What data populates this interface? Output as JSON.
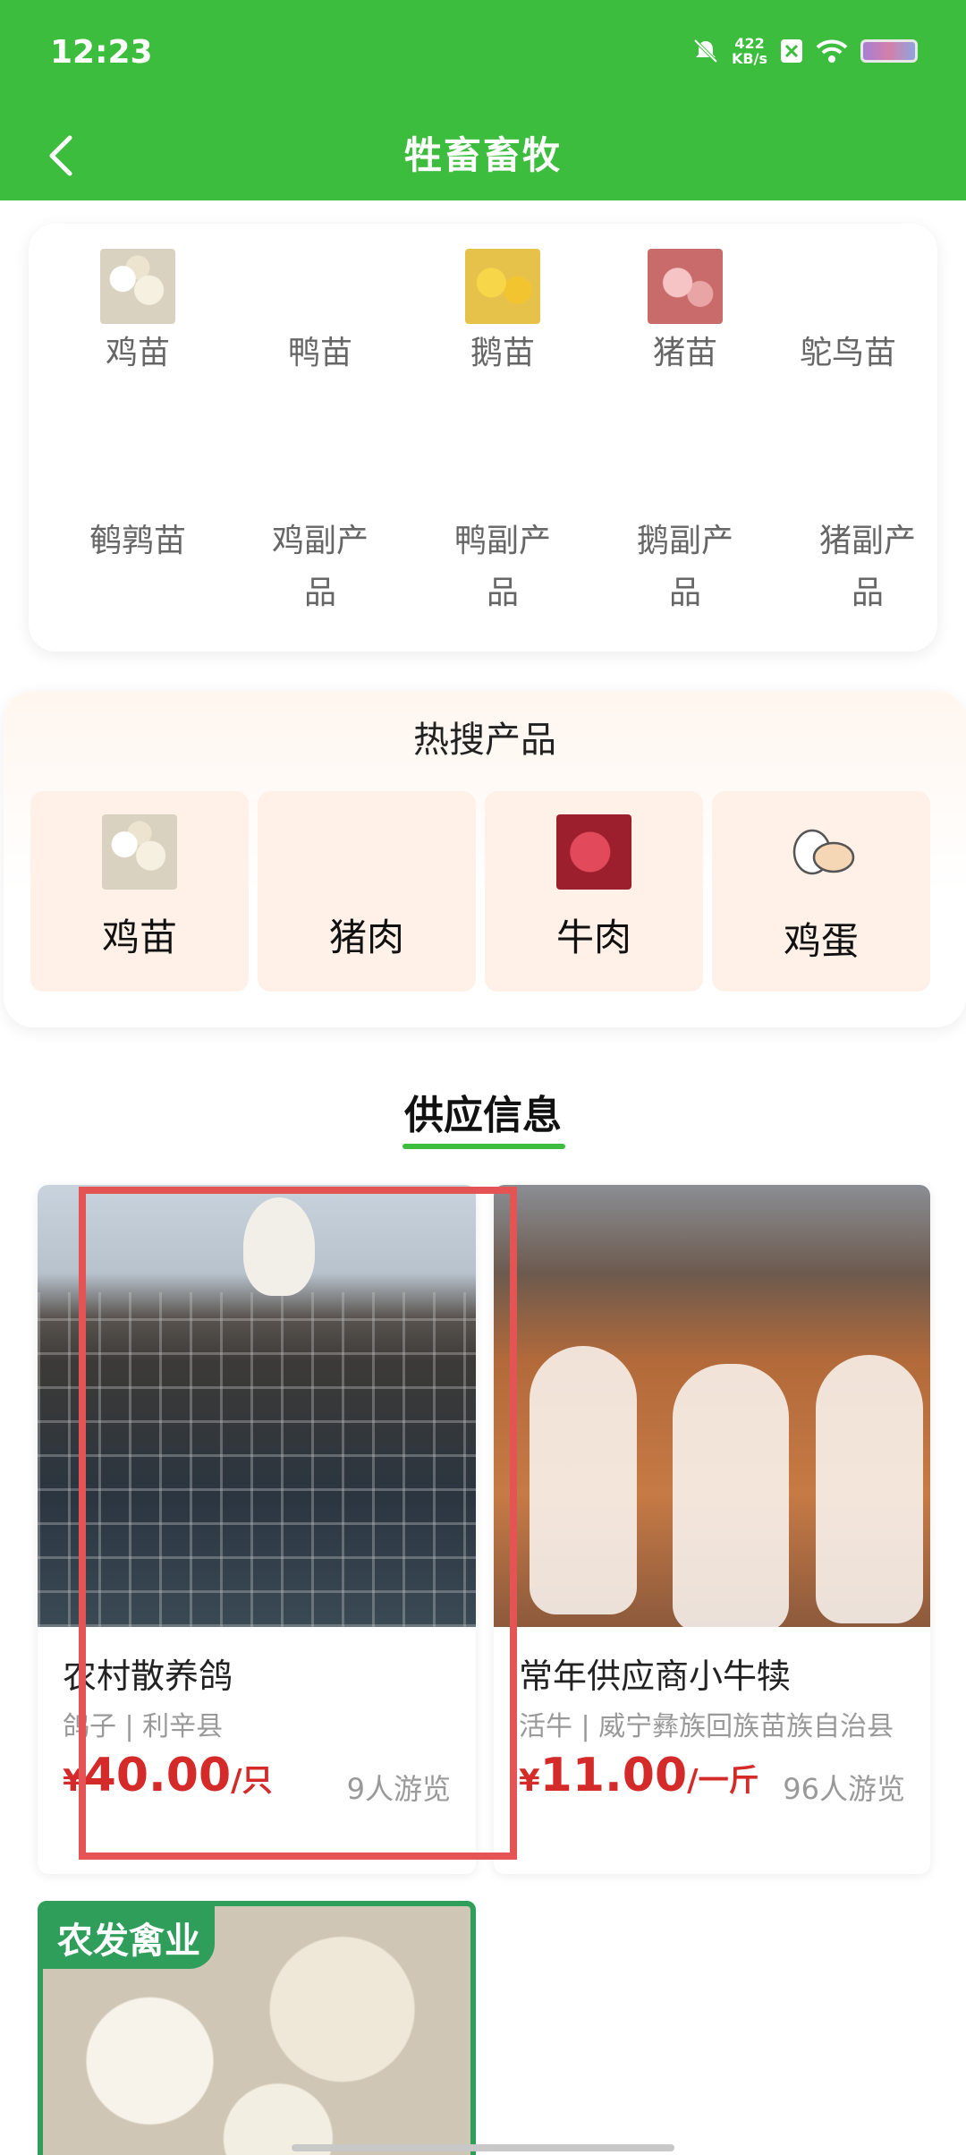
{
  "status_bar": {
    "time": "12:23",
    "net_speed_value": "422",
    "net_speed_unit": "KB/s"
  },
  "header": {
    "title": "牲畜畜牧"
  },
  "categories": [
    {
      "label": "鸡苗",
      "icon": "chick-thumbnail"
    },
    {
      "label": "鸭苗",
      "icon": ""
    },
    {
      "label": "鹅苗",
      "icon": "gosling-thumbnail"
    },
    {
      "label": "猪苗",
      "icon": "piglet-thumbnail"
    },
    {
      "label": "鸵鸟苗",
      "icon": ""
    },
    {
      "label": "鹌鹑苗",
      "icon": ""
    },
    {
      "label": "鸡副产品",
      "icon": ""
    },
    {
      "label": "鸭副产品",
      "icon": ""
    },
    {
      "label": "鹅副产品",
      "icon": ""
    },
    {
      "label": "猪副产品",
      "icon": ""
    }
  ],
  "hot_search": {
    "title": "热搜产品",
    "items": [
      {
        "label": "鸡苗",
        "icon": "chick-thumbnail"
      },
      {
        "label": "猪肉",
        "icon": ""
      },
      {
        "label": "牛肉",
        "icon": "beef-thumbnail"
      },
      {
        "label": "鸡蛋",
        "icon": "egg-icon"
      }
    ]
  },
  "supply": {
    "title": "供应信息",
    "products": [
      {
        "name": "农村散养鸽",
        "category": "鸽子",
        "location": "利辛县",
        "meta": "鸽子 | 利辛县",
        "currency": "¥",
        "price": "40.00",
        "unit": "/只",
        "views": "9人游览"
      },
      {
        "name": "常年供应商小牛犊",
        "category": "活牛",
        "location": "威宁彝族回族苗族自治县",
        "meta": "活牛 | 威宁彝族回族苗族自治县",
        "currency": "¥",
        "price": "11.00",
        "unit": "/一斤",
        "views": "96人游览"
      },
      {
        "badge": "农发禽业"
      }
    ]
  },
  "colors": {
    "primary_green": "#3dbd3d",
    "price_red": "#d42a2a",
    "highlight_red": "#e55454",
    "badge_green": "#2f9e5b"
  }
}
